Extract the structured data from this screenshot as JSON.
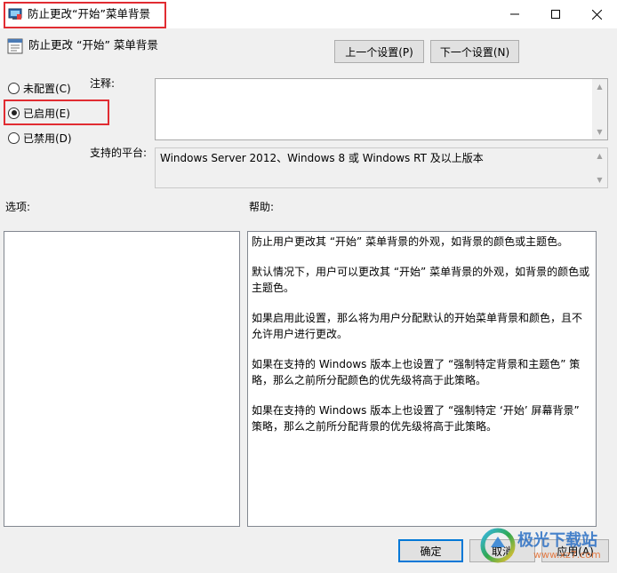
{
  "window": {
    "title": "防止更改“开始”菜单背景"
  },
  "header": {
    "policy_title": "防止更改 “开始” 菜单背景",
    "prev_button": "上一个设置(P)",
    "next_button": "下一个设置(N)"
  },
  "options": [
    {
      "label": "未配置(C)",
      "checked": false
    },
    {
      "label": "已启用(E)",
      "checked": true
    },
    {
      "label": "已禁用(D)",
      "checked": false
    }
  ],
  "comment": {
    "label": "注释:",
    "value": ""
  },
  "platform": {
    "label": "支持的平台:",
    "value": "Windows Server 2012、Windows 8 或 Windows RT 及以上版本"
  },
  "sections": {
    "options_label": "选项:",
    "help_label": "帮助:"
  },
  "help": {
    "paragraphs": [
      "防止用户更改其 “开始” 菜单背景的外观，如背景的颜色或主题色。",
      "默认情况下，用户可以更改其 “开始” 菜单背景的外观，如背景的颜色或主题色。",
      "如果启用此设置，那么将为用户分配默认的开始菜单背景和颜色，且不允许用户进行更改。",
      "如果在支持的 Windows 版本上也设置了 “强制特定背景和主题色” 策略，那么之前所分配颜色的优先级将高于此策略。",
      "如果在支持的 Windows 版本上也设置了 “强制特定 ‘开始’ 屏幕背景” 策略，那么之前所分配背景的优先级将高于此策略。"
    ]
  },
  "footer": {
    "ok_button": "确定",
    "cancel_button": "取消",
    "apply_button": "应用(A)"
  },
  "watermark": {
    "brand": "极光下载站",
    "url": "www.xz7.com"
  },
  "colors": {
    "highlight": "#e12c32",
    "accent": "#0078d7"
  }
}
